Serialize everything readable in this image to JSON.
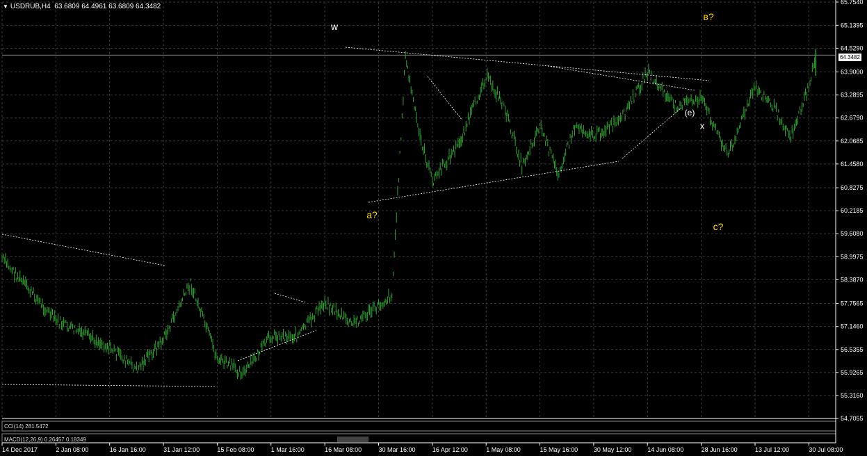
{
  "header": {
    "symbol": "USDRUB,H4",
    "ohlc": "63.6809 64.4961 63.6809 64.3482",
    "current_price_tag": "64.3482"
  },
  "indicators": {
    "cci_label": "CCI(14) 281.5472",
    "macd_label": "MACD(12,26,9) 0.26457 0.18349"
  },
  "colors": {
    "background": "#000000",
    "grid": "#3a3a3a",
    "candle": "#2fa52f",
    "trendline": "#ffffff",
    "wave_white": "#ffffff",
    "wave_yellow": "#ffd800"
  },
  "wave_labels": [
    {
      "text": "w",
      "color": "white"
    },
    {
      "text": "в?",
      "color": "yellow"
    },
    {
      "text": "a?",
      "color": "yellow"
    },
    {
      "text": "c?",
      "color": "yellow"
    },
    {
      "text": "(e)",
      "color": "white"
    },
    {
      "text": "x",
      "color": "white"
    }
  ],
  "chart_data": {
    "type": "line",
    "title": "USDRUB,H4",
    "ylim": [
      54.7055,
      65.754
    ],
    "y_ticks": [
      "65.7540",
      "65.1395",
      "64.5290",
      "63.9000",
      "63.2895",
      "62.6790",
      "62.0685",
      "61.4580",
      "60.8275",
      "60.2185",
      "59.6080",
      "58.9975",
      "58.3870",
      "57.7565",
      "57.1460",
      "56.5355",
      "55.9265",
      "55.3160",
      "54.7055"
    ],
    "x_ticks": [
      "14 Dec 2017",
      "2 Jan 08:00",
      "16 Jan 16:00",
      "31 Jan 12:00",
      "15 Feb 08:00",
      "1 Mar 16:00",
      "16 Mar 08:00",
      "30 Mar 16:00",
      "16 Apr 12:00",
      "1 May 08:00",
      "15 May 16:00",
      "30 May 12:00",
      "14 Jun 08:00",
      "28 Jun 16:00",
      "13 Jul 12:00",
      "30 Jul 08:00"
    ],
    "grid": true,
    "series": [
      {
        "values": [
          {
            "x": "14 Dec 2017",
            "y": 58.95
          },
          {
            "x": "2 Jan 08:00",
            "y": 57.3
          },
          {
            "x": "16 Jan 16:00",
            "y": 56.6
          },
          {
            "x": "25 Jan",
            "y": 56.0
          },
          {
            "x": "31 Jan 12:00",
            "y": 56.8
          },
          {
            "x": "5 Feb",
            "y": 58.3
          },
          {
            "x": "15 Feb 08:00",
            "y": 56.3
          },
          {
            "x": "22 Feb",
            "y": 55.9
          },
          {
            "x": "1 Mar 16:00",
            "y": 56.9
          },
          {
            "x": "10 Mar",
            "y": 56.9
          },
          {
            "x": "16 Mar 08:00",
            "y": 57.8
          },
          {
            "x": "22 Mar",
            "y": 57.2
          },
          {
            "x": "30 Mar 16:00",
            "y": 57.7
          },
          {
            "x": "6 Apr",
            "y": 58.0
          },
          {
            "x": "10 Apr",
            "y": 64.3
          },
          {
            "x": "13 Apr",
            "y": 62.3
          },
          {
            "x": "16 Apr 12:00",
            "y": 61.0
          },
          {
            "x": "24 Apr",
            "y": 62.0
          },
          {
            "x": "1 May 08:00",
            "y": 63.8
          },
          {
            "x": "6 May",
            "y": 63.0
          },
          {
            "x": "10 May",
            "y": 61.4
          },
          {
            "x": "15 May 16:00",
            "y": 62.5
          },
          {
            "x": "20 May",
            "y": 61.2
          },
          {
            "x": "25 May",
            "y": 62.5
          },
          {
            "x": "30 May 12:00",
            "y": 62.2
          },
          {
            "x": "5 Jun",
            "y": 62.6
          },
          {
            "x": "14 Jun 08:00",
            "y": 63.9
          },
          {
            "x": "20 Jun",
            "y": 63.0
          },
          {
            "x": "28 Jun 16:00",
            "y": 63.2
          },
          {
            "x": "3 Jul",
            "y": 61.7
          },
          {
            "x": "13 Jul 12:00",
            "y": 63.5
          },
          {
            "x": "20 Jul",
            "y": 63.0
          },
          {
            "x": "25 Jul",
            "y": 62.2
          },
          {
            "x": "30 Jul 08:00",
            "y": 63.5
          },
          {
            "x": "3 Aug",
            "y": 64.35
          }
        ]
      }
    ]
  }
}
